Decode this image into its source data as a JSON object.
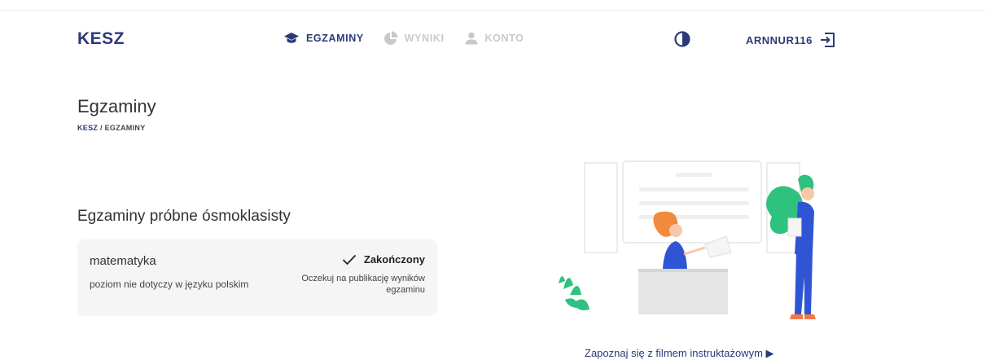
{
  "header": {
    "logo": "KESZ",
    "nav": [
      {
        "label": "EGZAMINY",
        "icon": "graduation-cap-icon",
        "active": true
      },
      {
        "label": "WYNIKI",
        "icon": "pie-chart-icon",
        "active": false
      },
      {
        "label": "KONTO",
        "icon": "user-icon",
        "active": false
      }
    ],
    "contrast_icon": "contrast-icon",
    "username": "ARNNUR116",
    "logout_icon": "logout-icon"
  },
  "page": {
    "title": "Egzaminy",
    "breadcrumb": {
      "root": "KESZ",
      "separator": " / ",
      "current": "EGZAMINY"
    }
  },
  "section": {
    "title": "Egzaminy próbne ósmoklasisty",
    "exams": [
      {
        "subject": "matematyka",
        "level": "poziom nie dotyczy w języku polskim",
        "status": "Zakończony",
        "note": "Oczekuj na publikację wyników egzaminu"
      }
    ]
  },
  "video_link": "Zapoznaj się z filmem instruktażowym ▶",
  "colors": {
    "brand": "#2b3a78",
    "inactive": "#c9c9c9",
    "card_bg": "#f5f5f5",
    "illustration_blue": "#2f55d4",
    "illustration_green": "#2ec27e",
    "illustration_orange": "#f08a3c"
  }
}
